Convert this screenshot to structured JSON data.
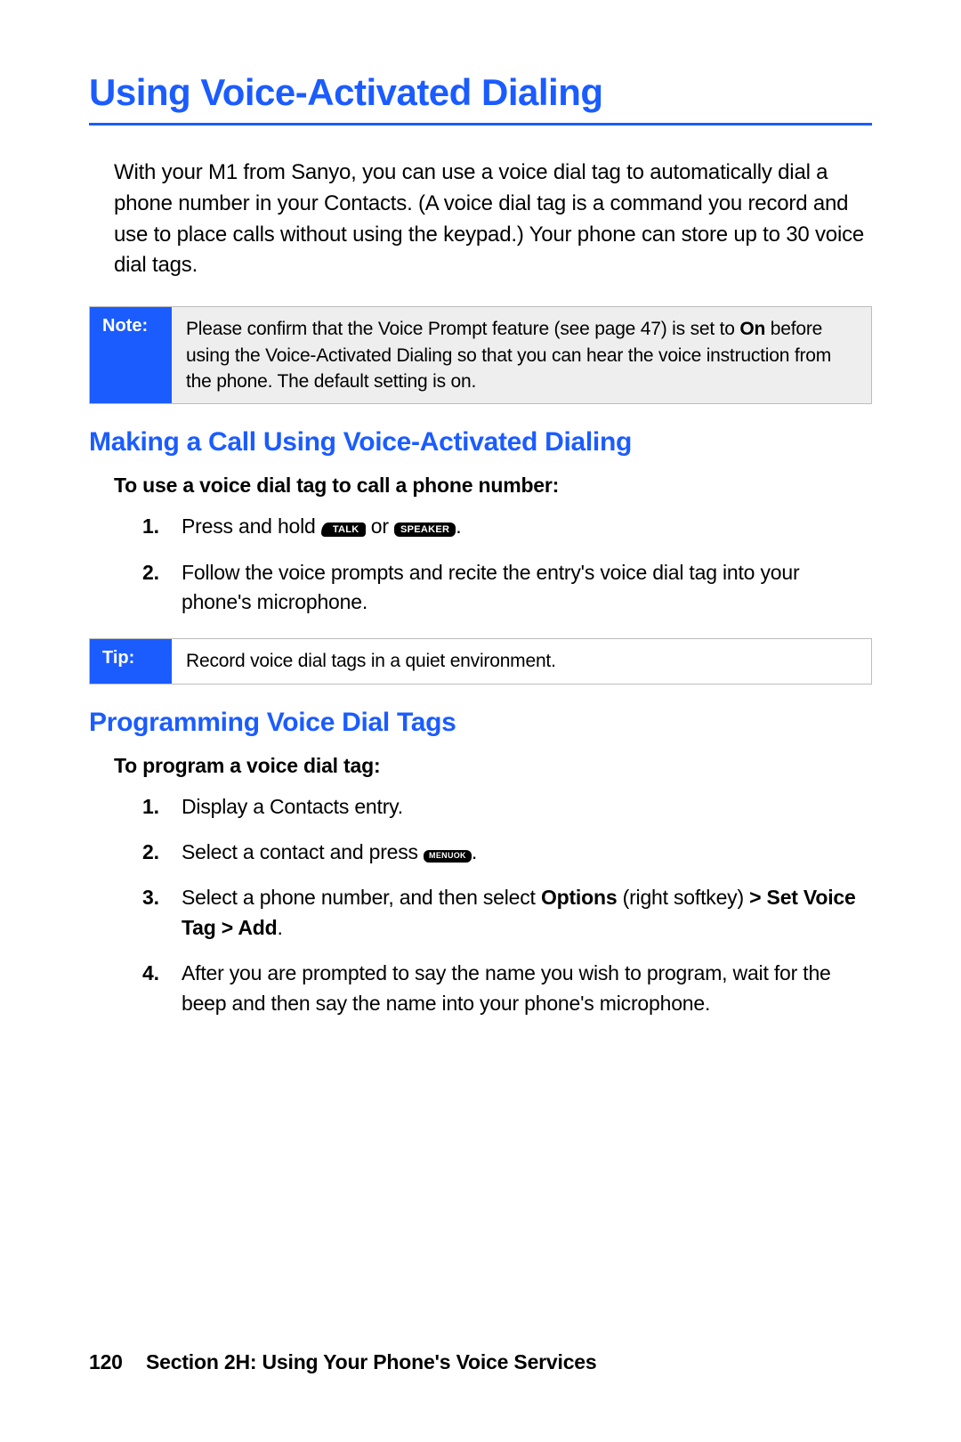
{
  "title": "Using Voice-Activated Dialing",
  "intro": "With your M1 from Sanyo, you can use a voice dial tag to automatically dial a phone number in your Contacts. (A voice dial tag is a command you record and use to place calls without using the keypad.) Your phone can store up to 30 voice dial tags.",
  "note": {
    "label": "Note:",
    "pre": "Please confirm that the Voice Prompt feature (see page 47) is set to ",
    "bold": "On",
    "post": " before using the Voice-Activated Dialing so that you can hear the voice instruction from the phone. The default setting is on."
  },
  "sec1": {
    "heading": "Making a Call Using Voice-Activated Dialing",
    "lead": "To use a voice dial tag to call a phone number:",
    "step1": {
      "pre": "Press and hold ",
      "mid": " or ",
      "post": "."
    },
    "step2": "Follow the voice prompts and recite the entry's voice dial tag into your phone's microphone."
  },
  "tip": {
    "label": "Tip:",
    "text": "Record voice dial tags in a quiet environment."
  },
  "sec2": {
    "heading": "Programming Voice Dial Tags",
    "lead": "To program a voice dial tag:",
    "step1": "Display a Contacts entry.",
    "step2": {
      "pre": "Select a contact and press ",
      "post": "."
    },
    "step3": {
      "pre": "Select a phone number, and then select ",
      "b1": "Options",
      "mid1": " (right softkey) ",
      "b2": "> Set Voice Tag > Add",
      "post": "."
    },
    "step4": "After you are prompted to say the name you wish to program, wait for the beep and then say the name into your phone's microphone."
  },
  "keys": {
    "talk": "TALK",
    "speaker": "SPEAKER",
    "menu": "MENU",
    "ok": "OK"
  },
  "footer": {
    "page": "120",
    "text": "Section 2H: Using Your Phone's Voice Services"
  }
}
